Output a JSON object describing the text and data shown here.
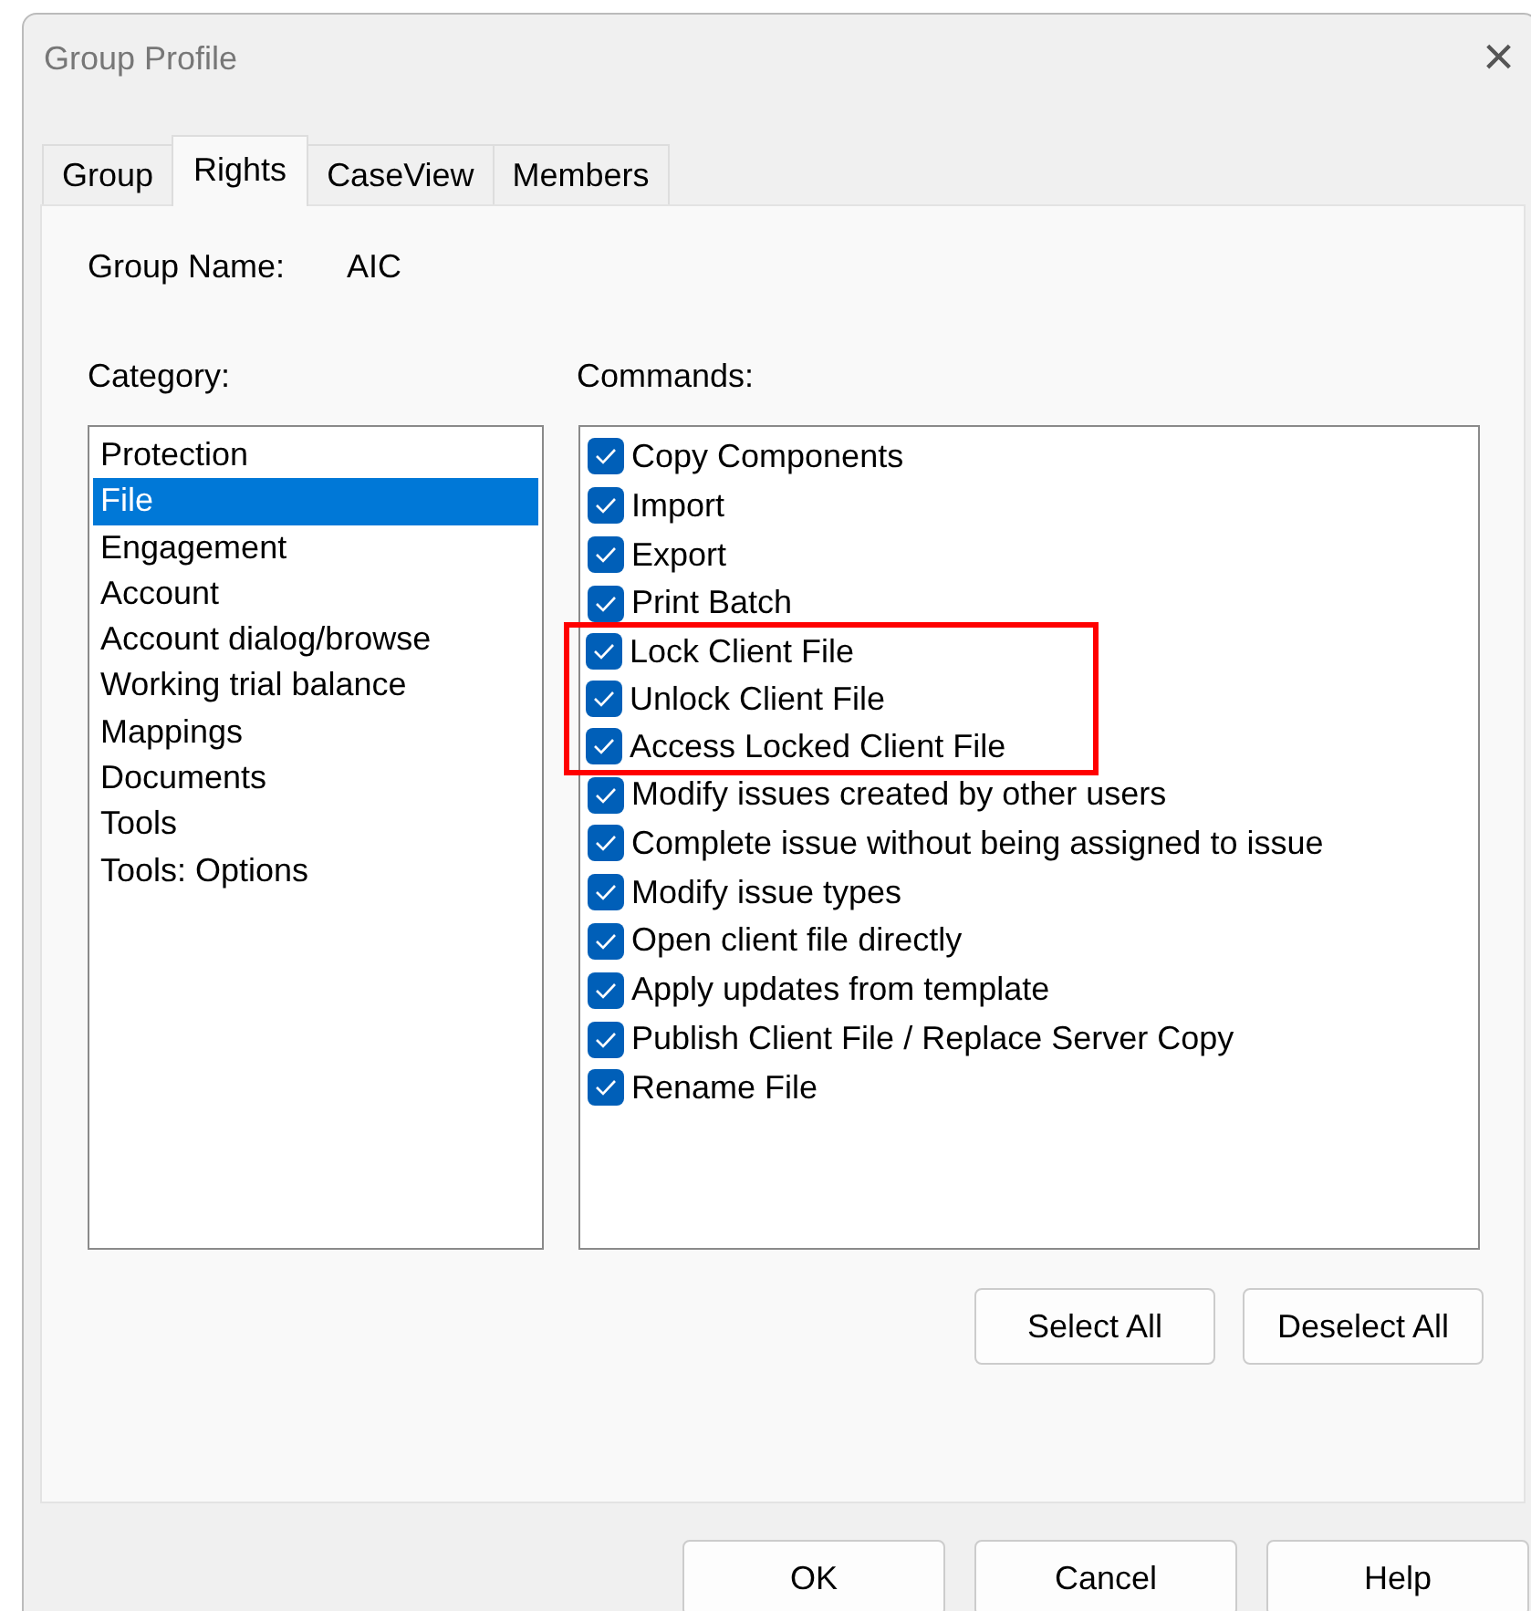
{
  "window": {
    "title": "Group Profile",
    "close": "×"
  },
  "tabs": [
    {
      "label": "Group",
      "selected": false
    },
    {
      "label": "Rights",
      "selected": true
    },
    {
      "label": "CaseView",
      "selected": false
    },
    {
      "label": "Members",
      "selected": false
    }
  ],
  "group_name": {
    "label": "Group Name:",
    "value": "AIC"
  },
  "category": {
    "label": "Category:",
    "items": [
      {
        "label": "Protection",
        "selected": false
      },
      {
        "label": "File",
        "selected": true
      },
      {
        "label": "Engagement",
        "selected": false
      },
      {
        "label": "Account",
        "selected": false
      },
      {
        "label": "Account dialog/browse",
        "selected": false
      },
      {
        "label": "Working trial balance",
        "selected": false
      },
      {
        "label": "Mappings",
        "selected": false
      },
      {
        "label": "Documents",
        "selected": false
      },
      {
        "label": "Tools",
        "selected": false
      },
      {
        "label": "Tools: Options",
        "selected": false
      }
    ]
  },
  "commands": {
    "label": "Commands:",
    "items": [
      {
        "label": "Copy Components",
        "checked": true,
        "highlighted": false
      },
      {
        "label": "Import",
        "checked": true,
        "highlighted": false
      },
      {
        "label": "Export",
        "checked": true,
        "highlighted": false
      },
      {
        "label": "Print Batch",
        "checked": true,
        "highlighted": false
      },
      {
        "label": "Lock Client File",
        "checked": true,
        "highlighted": true
      },
      {
        "label": "Unlock Client File",
        "checked": true,
        "highlighted": true
      },
      {
        "label": "Access Locked Client File",
        "checked": true,
        "highlighted": true
      },
      {
        "label": "Modify issues created by other users",
        "checked": true,
        "highlighted": false
      },
      {
        "label": "Complete issue without being assigned to issue",
        "checked": true,
        "highlighted": false
      },
      {
        "label": "Modify issue types",
        "checked": true,
        "highlighted": false
      },
      {
        "label": "Open client file directly",
        "checked": true,
        "highlighted": false
      },
      {
        "label": "Apply updates from template",
        "checked": true,
        "highlighted": false
      },
      {
        "label": "Publish Client File / Replace Server Copy",
        "checked": true,
        "highlighted": false
      },
      {
        "label": "Rename File",
        "checked": true,
        "highlighted": false
      }
    ]
  },
  "list_buttons": [
    "Select All",
    "Deselect All"
  ],
  "buttons": [
    "OK",
    "Cancel",
    "Help"
  ]
}
